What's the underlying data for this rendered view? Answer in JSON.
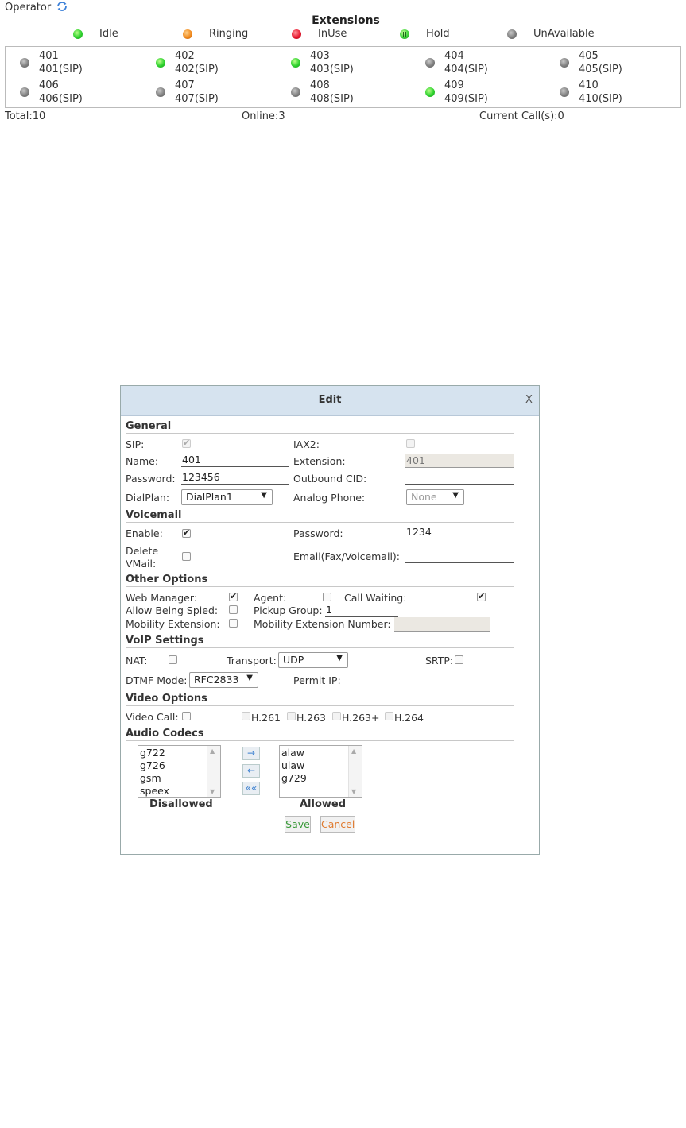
{
  "operator": {
    "label": "Operator",
    "refresh_icon": "refresh-icon"
  },
  "extensions": {
    "title": "Extensions",
    "legend": [
      {
        "status": "idle",
        "label": "Idle",
        "color": "#2ed12e"
      },
      {
        "status": "ringing",
        "label": "Ringing",
        "color": "#f08a1e"
      },
      {
        "status": "inuse",
        "label": "InUse",
        "color": "#e8172e"
      },
      {
        "status": "hold",
        "label": "Hold",
        "color": "#3ad23a"
      },
      {
        "status": "unavailable",
        "label": "UnAvailable",
        "color": "#808080"
      }
    ],
    "items": [
      {
        "number": "401",
        "name": "401(SIP)",
        "status": "unavailable"
      },
      {
        "number": "402",
        "name": "402(SIP)",
        "status": "idle"
      },
      {
        "number": "403",
        "name": "403(SIP)",
        "status": "idle"
      },
      {
        "number": "404",
        "name": "404(SIP)",
        "status": "unavailable"
      },
      {
        "number": "405",
        "name": "405(SIP)",
        "status": "unavailable"
      },
      {
        "number": "406",
        "name": "406(SIP)",
        "status": "unavailable"
      },
      {
        "number": "407",
        "name": "407(SIP)",
        "status": "unavailable"
      },
      {
        "number": "408",
        "name": "408(SIP)",
        "status": "unavailable"
      },
      {
        "number": "409",
        "name": "409(SIP)",
        "status": "idle"
      },
      {
        "number": "410",
        "name": "410(SIP)",
        "status": "unavailable"
      }
    ],
    "summary": {
      "total": "Total:10",
      "online": "Online:3",
      "current_calls": "Current Call(s):0"
    }
  },
  "dialog": {
    "title": "Edit",
    "close": "X",
    "general": {
      "heading": "General",
      "sip_label": "SIP:",
      "sip_checked": true,
      "iax2_label": "IAX2:",
      "iax2_checked": false,
      "name_label": "Name:",
      "name_value": "401",
      "extension_label": "Extension:",
      "extension_value": "401",
      "password_label": "Password:",
      "password_value": "123456",
      "outbound_cid_label": "Outbound CID:",
      "outbound_cid_value": "",
      "dialplan_label": "DialPlan:",
      "dialplan_value": "DialPlan1",
      "analog_phone_label": "Analog Phone:",
      "analog_phone_value": "None"
    },
    "voicemail": {
      "heading": "Voicemail",
      "enable_label": "Enable:",
      "enable_checked": true,
      "password_label": "Password:",
      "password_value": "1234",
      "delete_label_1": "Delete",
      "delete_label_2": "VMail:",
      "delete_checked": false,
      "email_label": "Email(Fax/Voicemail):",
      "email_value": ""
    },
    "other": {
      "heading": "Other Options",
      "web_manager_label": "Web Manager:",
      "web_manager_checked": true,
      "agent_label": "Agent:",
      "agent_checked": false,
      "call_waiting_label": "Call Waiting:",
      "call_waiting_checked": true,
      "allow_spied_label": "Allow Being Spied:",
      "allow_spied_checked": false,
      "pickup_group_label": "Pickup Group:",
      "pickup_group_value": "1",
      "mobility_ext_label": "Mobility Extension:",
      "mobility_ext_checked": false,
      "mobility_number_label": "Mobility Extension Number:",
      "mobility_number_value": ""
    },
    "voip": {
      "heading": "VoIP Settings",
      "nat_label": "NAT:",
      "nat_checked": false,
      "transport_label": "Transport:",
      "transport_value": "UDP",
      "srtp_label": "SRTP:",
      "srtp_checked": false,
      "dtmf_label": "DTMF Mode:",
      "dtmf_value": "RFC2833",
      "permit_ip_label": "Permit IP:",
      "permit_ip_value": ""
    },
    "video": {
      "heading": "Video Options",
      "video_call_label": "Video Call:",
      "video_call_checked": false,
      "codecs": [
        "H.261",
        "H.263",
        "H.263+",
        "H.264"
      ]
    },
    "audio": {
      "heading": "Audio Codecs",
      "disallowed": [
        "g722",
        "g726",
        "gsm",
        "speex"
      ],
      "allowed": [
        "alaw",
        "ulaw",
        "g729"
      ],
      "disallowed_caption": "Disallowed",
      "allowed_caption": "Allowed",
      "move_right": "→",
      "move_left": "←",
      "move_all_left": "««"
    },
    "buttons": {
      "save": "Save",
      "save_color": "#3a9a3a",
      "cancel": "Cancel",
      "cancel_color": "#e07a2e"
    }
  }
}
